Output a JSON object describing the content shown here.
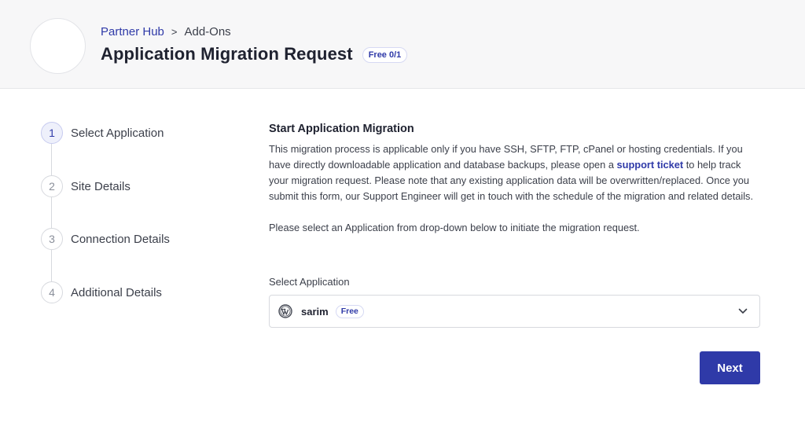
{
  "header": {
    "breadcrumb": {
      "parent": "Partner Hub",
      "separator": ">",
      "current": "Add-Ons"
    },
    "title": "Application Migration Request",
    "badge": "Free 0/1"
  },
  "steps": [
    {
      "number": "1",
      "label": "Select Application",
      "active": true
    },
    {
      "number": "2",
      "label": "Site Details",
      "active": false
    },
    {
      "number": "3",
      "label": "Connection Details",
      "active": false
    },
    {
      "number": "4",
      "label": "Additional Details",
      "active": false
    }
  ],
  "main": {
    "section_title": "Start Application Migration",
    "description_part1": "This migration process is applicable only if you have SSH, SFTP, FTP, cPanel or hosting credentials. If you have directly downloadable application and database backups, please open a ",
    "description_link": "support ticket",
    "description_part2": " to help track your migration request. Please note that any existing application data will be overwritten/replaced. Once you submit this form, our Support Engineer will get in touch with the schedule of the migration and related details.",
    "instruction": "Please select an Application from drop-down below to initiate the migration request.",
    "select_label": "Select Application",
    "select_value": "sarim",
    "select_tag": "Free",
    "select_icon": "wordpress-icon",
    "next_label": "Next"
  },
  "colors": {
    "accent": "#2f3aa8",
    "header_bg": "#f7f7f8"
  }
}
